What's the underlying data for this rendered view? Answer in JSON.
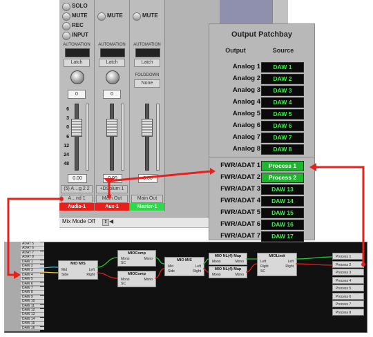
{
  "mixer": {
    "strip1": {
      "buttons": [
        "SOLO",
        "MUTE",
        "REC",
        "INPUT"
      ],
      "automation_label": "AUTOMATION",
      "automation_mode": "Latch",
      "pan_value": "0",
      "scale": [
        "6",
        "3",
        "0",
        "6",
        "12",
        "24",
        "48"
      ],
      "fader_value": "0.00",
      "io_label": "(5) A…g 2 2",
      "output_label": "A…nd 1",
      "track_name": "Audio-1"
    },
    "strip2": {
      "mute": "MUTE",
      "automation_label": "AUTOMATION",
      "automation_mode": "Latch",
      "pan_value": "0",
      "fader_value": "0.00",
      "io_label": "+DSplum 1",
      "output_label": "Main Out",
      "track_name": "Aux-1"
    },
    "strip3": {
      "mute": "MUTE",
      "automation_label": "AUTOMATION",
      "automation_mode": "Latch",
      "folddown_label": "FOLDDOWN",
      "folddown_value": "None",
      "fader_value": "0.00",
      "output_label": "Main Out",
      "track_name": "Master-1"
    },
    "status": "Mix Mode Off"
  },
  "patchbay": {
    "title": "Output Patchbay",
    "col_output": "Output",
    "col_source": "Source",
    "rows": [
      {
        "output": "Analog 1",
        "source": "DAW 1"
      },
      {
        "output": "Analog 2",
        "source": "DAW 2"
      },
      {
        "output": "Analog 3",
        "source": "DAW 3"
      },
      {
        "output": "Analog 4",
        "source": "DAW 4"
      },
      {
        "output": "Analog 5",
        "source": "DAW 5"
      },
      {
        "output": "Analog 6",
        "source": "DAW 6"
      },
      {
        "output": "Analog 7",
        "source": "DAW 7"
      },
      {
        "output": "Analog 8",
        "source": "DAW 8"
      },
      {
        "output": "FWR/ADAT 1",
        "source": "Process 1"
      },
      {
        "output": "FWR/ADAT 2",
        "source": "Process 2"
      },
      {
        "output": "FWR/ADAT 3",
        "source": "DAW 13"
      },
      {
        "output": "FWR/ADAT 4",
        "source": "DAW 14"
      },
      {
        "output": "FWR/ADAT 5",
        "source": "DAW 15"
      },
      {
        "output": "FWR/ADAT 6",
        "source": "DAW 16"
      },
      {
        "output": "FWR/ADAT 7",
        "source": "DAW 17"
      }
    ]
  },
  "graph": {
    "inputs": [
      "ADAT 5",
      "ADAT 6",
      "ADAT 7",
      "ADAT 8",
      "DAW 1",
      "DAW 2",
      "DAW 3",
      "DAW 4",
      "DAW 5",
      "DAW 6",
      "DAW 7",
      "DAW 8",
      "DAW 9",
      "DAW 10",
      "DAW 11",
      "DAW 12",
      "DAW 13",
      "DAW 14",
      "DAW 15",
      "DAW 16"
    ],
    "nodes": {
      "ms1": {
        "title": "MIO M/S",
        "in1": "Mid",
        "in2": "Side",
        "out1": "Left",
        "out2": "Right"
      },
      "comp1": {
        "title": "MIOComp",
        "in1": "Mono",
        "in2": "SC",
        "out1": "Mono"
      },
      "comp2": {
        "title": "MIOComp",
        "in1": "Mono",
        "in2": "SC",
        "out1": "Mono"
      },
      "ms2": {
        "title": "MIO M/S",
        "in1": "Mid",
        "in2": "Side",
        "out1": "Left",
        "out2": "Right"
      },
      "map1": {
        "title": "MIO NL(4) Map",
        "in1": "Mono",
        "out1": "Mono"
      },
      "map2": {
        "title": "MIO NL(4) Map",
        "in1": "Mono",
        "out1": "Mono"
      },
      "limit": {
        "title": "MIOLimit",
        "in1": "Left",
        "in2": "Right",
        "in3": "SC",
        "out1": "Left",
        "out2": "Right"
      }
    },
    "outputs": [
      "Process 1",
      "Process 2",
      "Process 3",
      "Process 4",
      "Process 5",
      "Process 6",
      "Process 7",
      "Process 8"
    ],
    "colors": {
      "cable_red": "#e8201c",
      "cable_green": "#1fcf3a",
      "cable_cyan": "#3ec6f0",
      "cable_yellow": "#f0d43c"
    }
  }
}
